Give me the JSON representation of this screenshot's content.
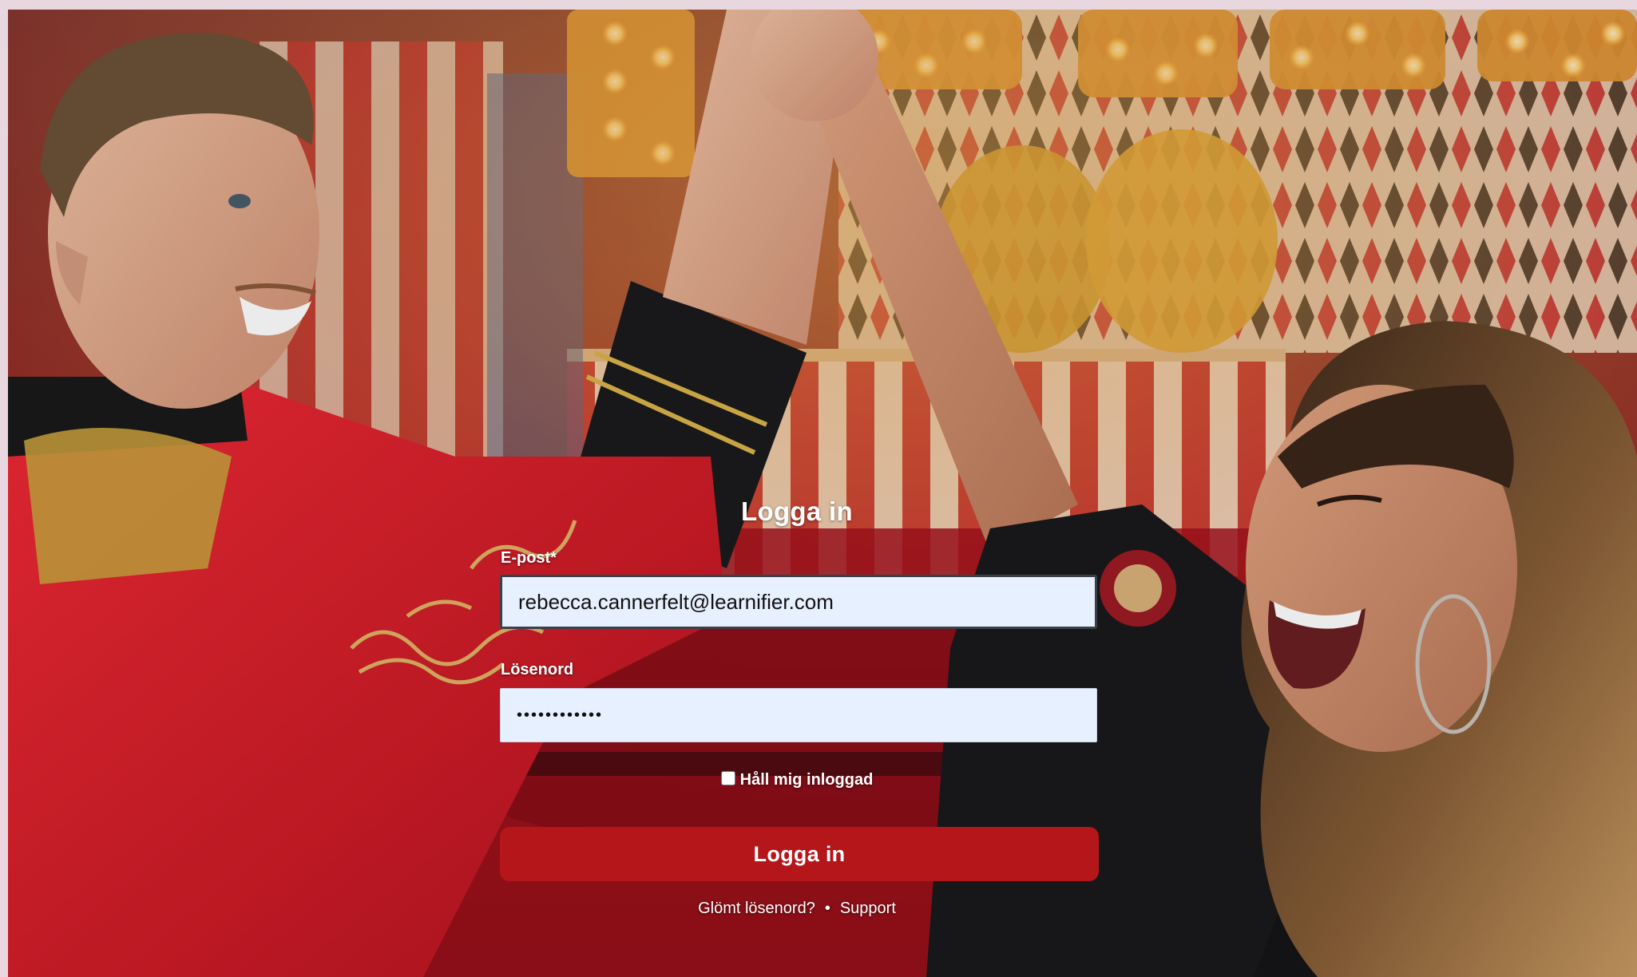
{
  "login": {
    "title": "Logga in",
    "email_label": "E-post*",
    "email_value": "rebecca.cannerfelt@learnifier.com",
    "password_label": "Lösenord",
    "password_value": "••••••••••••",
    "remember_label": "Håll mig inloggad",
    "remember_checked": false,
    "submit_label": "Logga in",
    "forgot_password_link": "Glömt lösenord?",
    "separator": "•",
    "support_link": "Support"
  },
  "colors": {
    "button": "#b5161a",
    "input_background": "#e7f0fe",
    "page_frame": "#e9d7df"
  },
  "background_photo": {
    "description_icon": "circus-high-five-photo"
  }
}
